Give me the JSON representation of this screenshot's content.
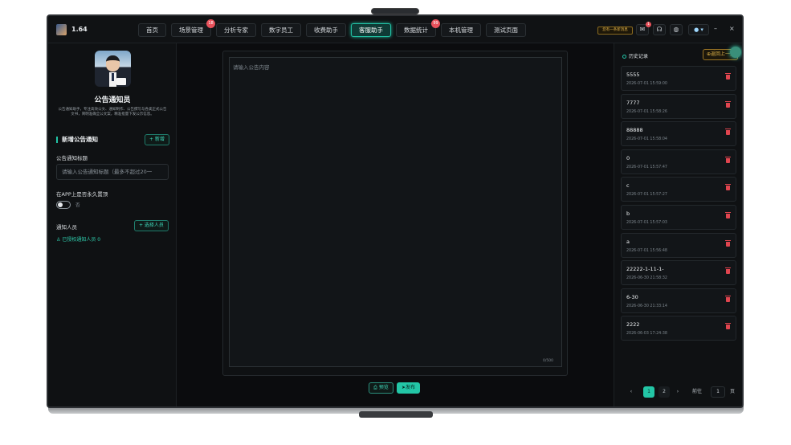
{
  "app": {
    "version": "1.64"
  },
  "nav": [
    {
      "label": "首页",
      "badge": ""
    },
    {
      "label": "场景管理",
      "badge": "18"
    },
    {
      "label": "分析专家",
      "badge": ""
    },
    {
      "label": "数字员工",
      "badge": ""
    },
    {
      "label": "收费助手",
      "badge": ""
    },
    {
      "label": "客服助手",
      "badge": "",
      "active": true
    },
    {
      "label": "数据统计",
      "badge": "99"
    },
    {
      "label": "本机管理",
      "badge": ""
    },
    {
      "label": "测试页面",
      "badge": ""
    }
  ],
  "topbar": {
    "notice": "您有一条新消息",
    "message_badge": "1"
  },
  "left": {
    "role_title": "公告通知员",
    "role_desc": "公告通知助手，专注高效公文、通知制作、公告撰写与各类正式公告文书，简明准确全公文案，精准批量下发公示信息。",
    "section_title": "新增公告通知",
    "add_label": "+ 新增",
    "title_label": "公告通知标题",
    "title_placeholder": "请输入公告通知标题（最多不超过20一",
    "pin_label": "在APP上是否永久置顶",
    "pin_value": "否",
    "notify_label": "通知人员",
    "select_label": "+ 选择人员",
    "authorized_label": "已授权通知人员 0"
  },
  "editor": {
    "placeholder": "请输入公告内容",
    "counter": "0/500",
    "preview_label": "预览",
    "publish_label": "发布"
  },
  "history": {
    "title": "历史记录",
    "back_label": "返回上一页",
    "items": [
      {
        "name": "5555",
        "time": "2026-07-01 15:59:00"
      },
      {
        "name": "7777",
        "time": "2026-07-01 15:58:26"
      },
      {
        "name": "88888",
        "time": "2026-07-01 15:58:04"
      },
      {
        "name": "0",
        "time": "2026-07-01 15:57:47"
      },
      {
        "name": "c",
        "time": "2026-07-01 15:57:27"
      },
      {
        "name": "b",
        "time": "2026-07-01 15:57:03"
      },
      {
        "name": "a",
        "time": "2026-07-01 15:56:48"
      },
      {
        "name": "22222-1-11-1-",
        "time": "2026-06-30 21:58:32"
      },
      {
        "name": "6-30",
        "time": "2026-06-30 21:33:14"
      },
      {
        "name": "2222",
        "time": "2026-06-03 17:24:38"
      }
    ]
  },
  "pagination": {
    "prev": "‹",
    "page1": "1",
    "page2": "2",
    "next": "›",
    "goto_label": "前往",
    "goto_value": "1",
    "page_suffix": "页"
  },
  "colors": {
    "accent": "#23c6a6",
    "danger": "#e0454f",
    "warning": "#e0b449",
    "background": "#0c0e10"
  }
}
